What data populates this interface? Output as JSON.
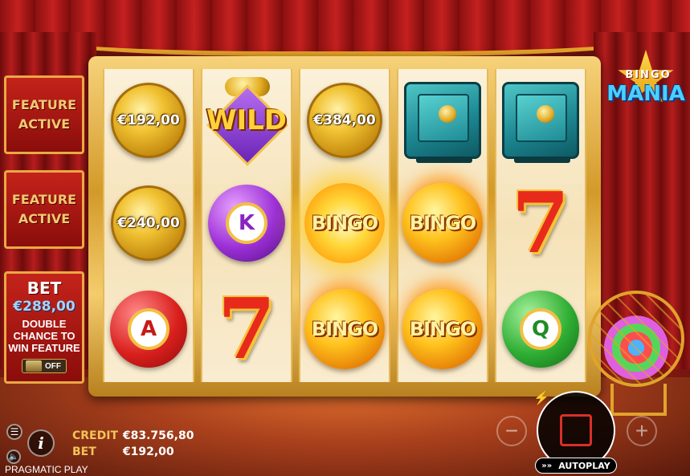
{
  "logo": {
    "line1": "BINGO",
    "line2": "MANIA"
  },
  "side_panel": {
    "feature1": "FEATURE ACTIVE",
    "feature2": "FEATURE ACTIVE",
    "bet_title": "BET",
    "bet_amount": "€288,00",
    "bet_desc": "DOUBLE CHANCE TO WIN FEATURE",
    "toggle_state": "OFF"
  },
  "reels": {
    "r1": {
      "row1": "€192,00",
      "row2": "€240,00",
      "row3_letter": "A"
    },
    "r2": {
      "row1": "WILD",
      "row2_letter": "K",
      "row3": "7"
    },
    "r3": {
      "row1": "€384,00",
      "row2": "BINGO",
      "row3": "BINGO"
    },
    "r4": {
      "row2": "BINGO",
      "row3": "BINGO"
    },
    "r5": {
      "row2": "7",
      "row3_letter": "Q"
    }
  },
  "bottom": {
    "credit_label": "CREDIT",
    "credit_value": "€83.756,80",
    "bet_label": "BET",
    "bet_value": "€192,00",
    "brand": "PRAGMATIC PLAY",
    "info_label": "i",
    "autoplay_label": "AUTOPLAY"
  },
  "colors": {
    "accent_gold": "#f2c458",
    "spin_red": "#d9302a",
    "bet_blue": "#9fd6ff"
  },
  "icons": {
    "menu": "hamburger-icon",
    "sound": "speaker-icon",
    "turbo": "lightning-icon"
  }
}
